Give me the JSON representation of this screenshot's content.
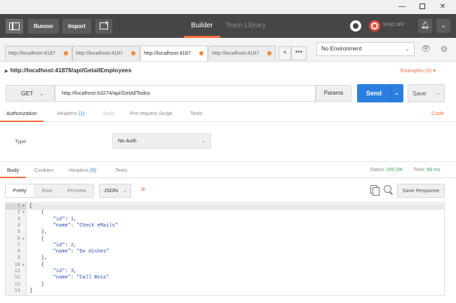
{
  "toolbar": {
    "runner_label": "Runner",
    "import_label": "Import",
    "mode_builder": "Builder",
    "mode_team_library": "Team Library",
    "sync_label": "SYNC OFF"
  },
  "tabs": [
    {
      "label": "http://localhost:4187",
      "active": false
    },
    {
      "label": "http://localhost:4187",
      "active": false
    },
    {
      "label": "http://localhost:4187",
      "active": true
    },
    {
      "label": "http://localhost:4187",
      "active": false
    }
  ],
  "tab_add_label": "+",
  "tab_more_label": "•••",
  "environment": {
    "selected": "No Environment"
  },
  "request": {
    "name": "http://localhost:41878/api/GetallEmployees",
    "examples_label": "Examples (0) ▾",
    "method": "GET",
    "url": "http://localhost:63274/api/GetAllTodos",
    "params_label": "Params",
    "send_label": "Send",
    "save_label": "Save"
  },
  "request_tabs": {
    "authorization": "Authorization",
    "headers": "Headers",
    "headers_count": "(1)",
    "body": "Body",
    "prerequest": "Pre-request Script",
    "tests": "Tests",
    "code": "Code"
  },
  "auth": {
    "type_label": "Type",
    "selected": "No Auth"
  },
  "response_tabs": {
    "body": "Body",
    "cookies": "Cookies",
    "headers": "Headers",
    "headers_count": "(6)",
    "tests": "Tests"
  },
  "response_status": {
    "status_label": "Status:",
    "status_value": "200 OK",
    "time_label": "Time:",
    "time_value": "68 ms"
  },
  "response_view": {
    "pretty": "Pretty",
    "raw": "Raw",
    "preview": "Preview",
    "format": "JSON",
    "save_response": "Save Response"
  },
  "code_lines": [
    "[",
    "    {",
    "        \"id\": 1,",
    "        \"name\": \"Check eMails\"",
    "    },",
    "    {",
    "        \"id\": 2,",
    "        \"name\": \"Do dishes\"",
    "    },",
    "    {",
    "        \"id\": 3,",
    "        \"name\": \"Call Boss\"",
    "    }",
    "]"
  ],
  "line_numbers": [
    "1",
    "2",
    "3",
    "4",
    "5",
    "6",
    "7",
    "8",
    "9",
    "10",
    "11",
    "12",
    "13",
    "14"
  ],
  "colors": {
    "accent_orange": "#f26b3a",
    "send_blue": "#2a7fe0",
    "toolbar_dark": "#464646",
    "status_green": "#3aa757"
  }
}
